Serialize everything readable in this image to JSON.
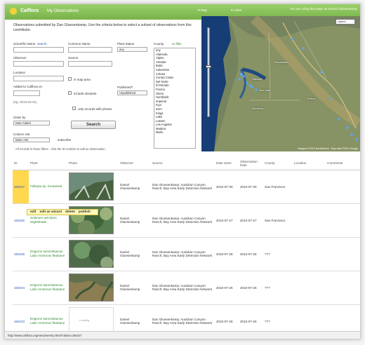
{
  "header": {
    "brand": "Calflora",
    "tab": "My Observations",
    "map_link": "▾ Map",
    "links_link": "▾ Links",
    "user_note": "You are using this page as Daniel Gluesenkamp"
  },
  "intro": "Observations submitted by Dan Gluesenkamp. Use the criteria below to select a subset of observations from this contributor.",
  "form": {
    "scientific_name": "Scientific Name",
    "search_link": "search",
    "common_name": "Common Name",
    "plant_status": "Plant Status",
    "plant_status_value": "any",
    "observer": "Observer",
    "source": "Source",
    "location": "Location",
    "in_map_area": "in map area",
    "added_label": "Added to Calflora on",
    "include_obsolete": "include obsolete",
    "published": "Published?",
    "published_value": "Unpublished",
    "example_date": "(eg. 2013-03-31)",
    "photos_only": "only records with photos",
    "order_by": "Order by",
    "order_value": "Date Added",
    "search_button": "Search",
    "column_set": "Column Set",
    "column_value": "Basic Info",
    "subscribe": "subscribe"
  },
  "county": {
    "label": "County",
    "none": "no filter",
    "items": [
      "any",
      "Alameda",
      "Alpine",
      "Amador",
      "Butte",
      "Calaveras",
      "Colusa",
      "Contra Costa",
      "Del Norte",
      "El Dorado",
      "Fresno",
      "Glenn",
      "Humboldt",
      "Imperial",
      "Inyo",
      "Kern",
      "Kings",
      "Lake",
      "Lassen",
      "Los Angeles",
      "Madera",
      "Marin"
    ]
  },
  "map": {
    "hybrid": "Hybrid",
    "copyright": "Imagery ©2013 TerraMetrics · Map data ©2013 Google",
    "place_labels": [
      "Sacramento",
      "Oakland",
      "San Jose",
      "Fresno",
      "Monterey"
    ]
  },
  "results_note": "All records in these filters · click the ID number to edit an observation.",
  "table": {
    "headers": [
      "ID",
      "Plant",
      "Photo",
      "Observer",
      "Source",
      "Date Seen",
      "Observation Date",
      "County",
      "Location",
      "Comments"
    ],
    "rows": [
      {
        "id": "obs027",
        "plant": "Fallopia sp. Knotweed",
        "photo": "",
        "observer": "Daniel Gluesenkamp",
        "source": "Dan Gluesenkamp: Audubon Canyon Ranch; Bay Area Early Detection Network",
        "date_seen": "2010-07-30",
        "observation_date": "2010-07-30",
        "county": "San Francisco"
      },
      {
        "id": "obs026",
        "plant": "Solanum aviculare Nightshade",
        "photo": "",
        "observer": "Daniel Gluesenkamp",
        "source": "Dan Gluesenkamp: Audubon Canyon Ranch; Bay Area Early Detection Network",
        "date_seen": "2010-07-27",
        "observation_date": "2010-07-27",
        "county": "San Francisco"
      },
      {
        "id": "obs025",
        "plant": "Erigeron karvinskianus Latin American fleabane",
        "photo": "",
        "observer": "Daniel Gluesenkamp",
        "source": "Dan Gluesenkamp: Audubon Canyon Ranch; Bay Area Early Detection Network",
        "date_seen": "2010-07-26",
        "observation_date": "2010-07-26",
        "county": "???"
      },
      {
        "id": "obs024",
        "plant": "Erigeron karvinskianus Latin American fleabane",
        "photo": "",
        "observer": "Daniel Gluesenkamp",
        "source": "Dan Gluesenkamp: Audubon Canyon Ranch; Bay Area Early Detection Network",
        "date_seen": "2010-07-26",
        "observation_date": "2010-07-26",
        "county": "???"
      },
      {
        "id": "obs023",
        "plant": "Erigeron karvinskianus Latin American fleabane",
        "photo": "Loading",
        "observer": "Daniel Gluesenkamp",
        "source": "Dan Gluesenkamp: Audubon Canyon Ranch; Bay Area Early Detection Network",
        "date_seen": "2010-07-26",
        "observation_date": "2010-07-26",
        "county": "???"
      }
    ]
  },
  "action_menu": [
    "edit",
    "edit as wizard",
    "delete",
    "publish"
  ],
  "status_bar": "http://www.calflora.org/entry/wentry.html?obsId=obs027"
}
